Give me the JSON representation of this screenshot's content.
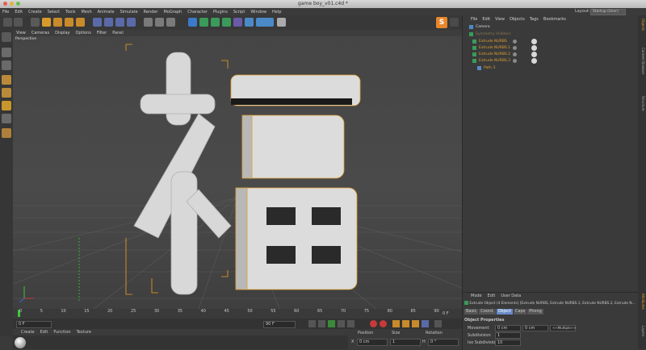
{
  "window": {
    "title": "game boy_v01.c4d *"
  },
  "menubar": [
    "File",
    "Edit",
    "Create",
    "Select",
    "Tools",
    "Mesh",
    "Animate",
    "Simulate",
    "Render",
    "MoGraph",
    "Character",
    "Plugins",
    "Script",
    "Window",
    "Help"
  ],
  "layout": {
    "label": "Layout:",
    "value": "Startup (User)"
  },
  "viewport": {
    "menu": [
      "View",
      "Cameras",
      "Display",
      "Options",
      "Filter",
      "Panel"
    ],
    "label": "Perspective",
    "glyph": "福"
  },
  "timeline": {
    "ticks": [
      "0",
      "5",
      "10",
      "15",
      "20",
      "25",
      "30",
      "35",
      "40",
      "45",
      "50",
      "55",
      "60",
      "65",
      "70",
      "75",
      "80",
      "85",
      "90"
    ],
    "frame_end": "0 F",
    "start_field": "0 F",
    "end_field": "90 F"
  },
  "material": {
    "menu": [
      "Create",
      "Edit",
      "Function",
      "Texture"
    ]
  },
  "coords": {
    "headers": [
      "Position",
      "Size",
      "Rotation"
    ],
    "row": {
      "axis": "X",
      "pos": "0 cm",
      "size": "1",
      "rot": "H",
      "rot_val": "0 °"
    }
  },
  "objects": {
    "menu": [
      "File",
      "Edit",
      "View",
      "Objects",
      "Tags",
      "Bookmarks"
    ],
    "rows": [
      {
        "name": "Camera",
        "color": "#d8d8d8"
      },
      {
        "name": "Symmetry (hidden)",
        "color": "#e0a030"
      },
      {
        "name": "Extrude NURBS",
        "color": "#e0a030"
      },
      {
        "name": "Extrude NURBS.1",
        "color": "#e0a030"
      },
      {
        "name": "Extrude NURBS.2",
        "color": "#e0a030"
      },
      {
        "name": "Extrude NURBS.3",
        "color": "#e0a030"
      },
      {
        "name": "Path 3",
        "color": "#e0a030"
      }
    ]
  },
  "attributes": {
    "menu": [
      "Mode",
      "Edit",
      "User Data"
    ],
    "summary": "Extrude Object (4 Elements) [Extrude NURBS, Extrude NURBS.1, Extrude NURBS.2, Extrude N...",
    "tabs": [
      "Basic",
      "Coord.",
      "Object",
      "Caps",
      "Phong"
    ],
    "active_tab": "Object",
    "section": "Object Properties",
    "fields": [
      {
        "label": "Movement",
        "v1": "0 cm",
        "v2": "0 cm",
        "v3": "<<Multiple>>"
      },
      {
        "label": "Subdivision",
        "v1": "1"
      },
      {
        "label": "Iso Subdivision",
        "v1": "10"
      }
    ]
  },
  "right_tabs": [
    "Objects",
    "Content Browser",
    "Structure",
    "Attributes",
    "Layers"
  ],
  "colors": {
    "accent": "#e0a030",
    "selection": "#f0a020",
    "bg": "#3a3a3a"
  }
}
